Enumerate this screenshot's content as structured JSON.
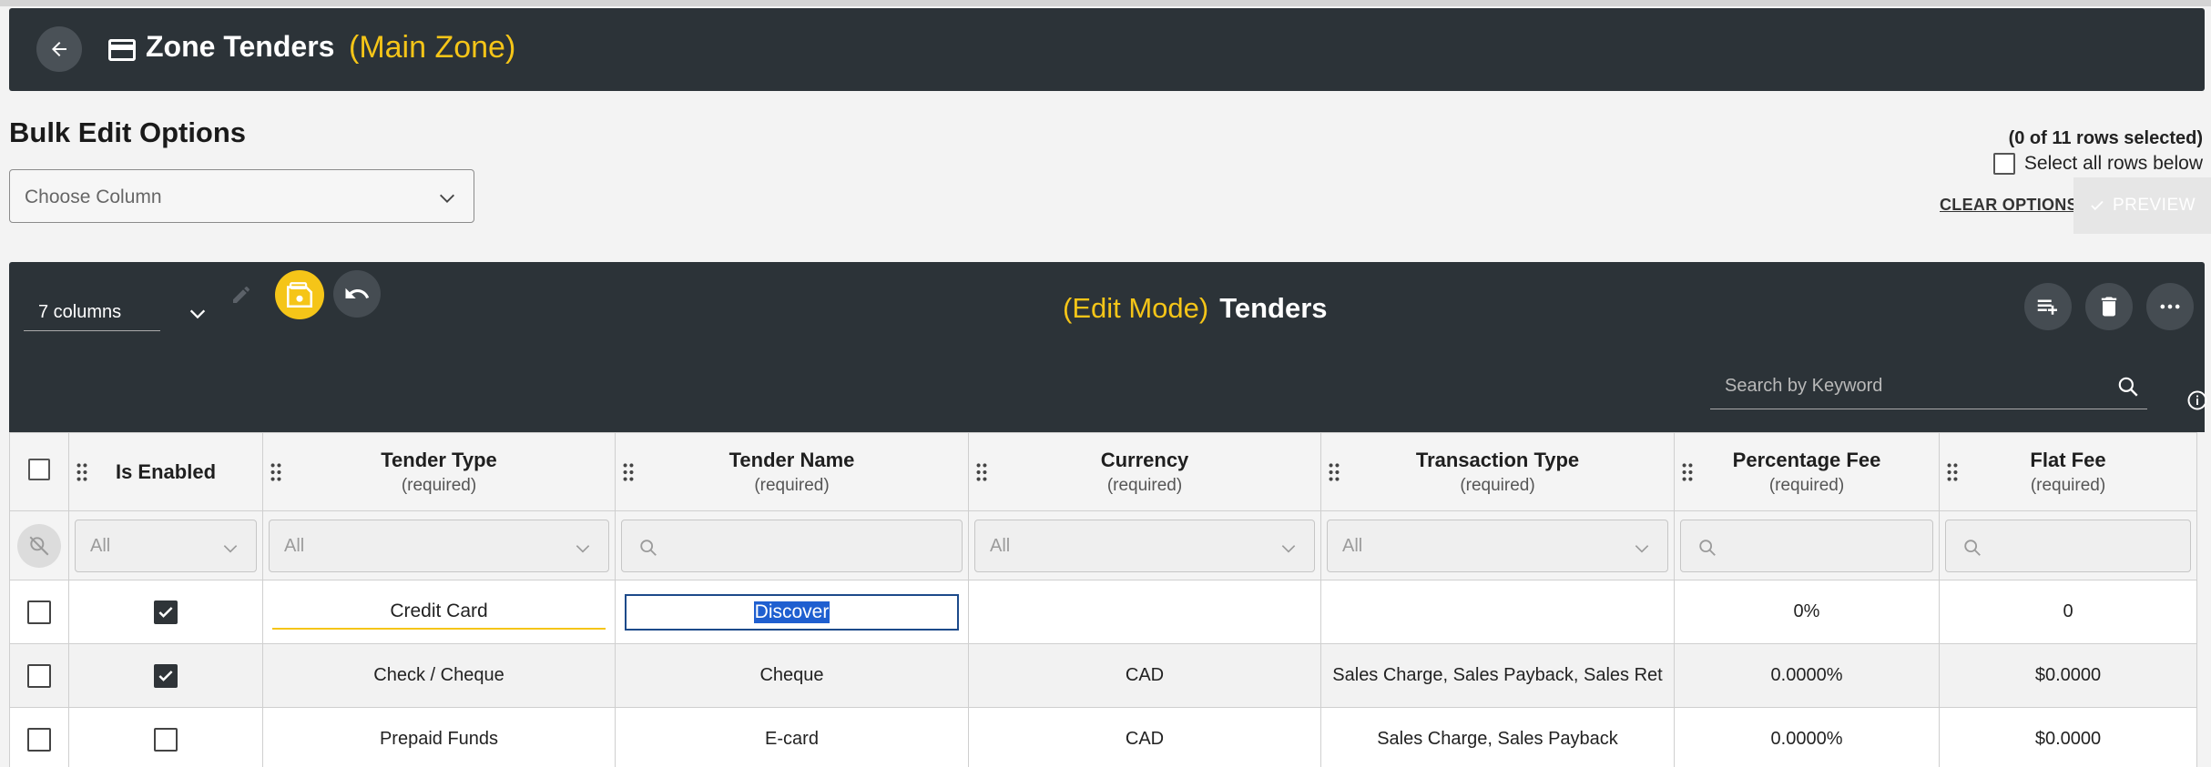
{
  "header": {
    "title": "Zone Tenders",
    "zone": "(Main Zone)"
  },
  "bulk": {
    "title": "Bulk Edit Options",
    "choose_column_placeholder": "Choose Column",
    "rows_selected": "(0 of 11 rows selected)",
    "select_all_label": "Select all rows below",
    "clear_options": "CLEAR OPTIONS",
    "preview": "PREVIEW"
  },
  "grid": {
    "columns_label": "7 columns",
    "mode": "(Edit Mode)",
    "title": "Tenders",
    "search_placeholder": "Search by Keyword",
    "columns": [
      {
        "label": "Is Enabled",
        "sub": ""
      },
      {
        "label": "Tender Type",
        "sub": "(required)"
      },
      {
        "label": "Tender Name",
        "sub": "(required)"
      },
      {
        "label": "Currency",
        "sub": "(required)"
      },
      {
        "label": "Transaction Type",
        "sub": "(required)"
      },
      {
        "label": "Percentage Fee",
        "sub": "(required)"
      },
      {
        "label": "Flat Fee",
        "sub": "(required)"
      }
    ],
    "filters": {
      "tender_type": "All",
      "is_enabled": "All",
      "currency": "All",
      "transaction_type": "All"
    },
    "rows": [
      {
        "enabled": true,
        "tender_type": "Credit Card",
        "tender_name": "Discover",
        "currency": "",
        "transaction_type": "",
        "percentage_fee": "0%",
        "flat_fee": "0"
      },
      {
        "enabled": true,
        "tender_type": "Check / Cheque",
        "tender_name": "Cheque",
        "currency": "CAD",
        "transaction_type": "Sales Charge, Sales Payback, Sales Ret",
        "percentage_fee": "0.0000%",
        "flat_fee": "$0.0000"
      },
      {
        "enabled": false,
        "tender_type": "Prepaid Funds",
        "tender_name": "E-card",
        "currency": "CAD",
        "transaction_type": "Sales Charge, Sales Payback",
        "percentage_fee": "0.0000%",
        "flat_fee": "$0.0000"
      }
    ]
  },
  "colors": {
    "accent": "#f5c518",
    "dark": "#2c3338",
    "selection": "#1f5fd0"
  }
}
